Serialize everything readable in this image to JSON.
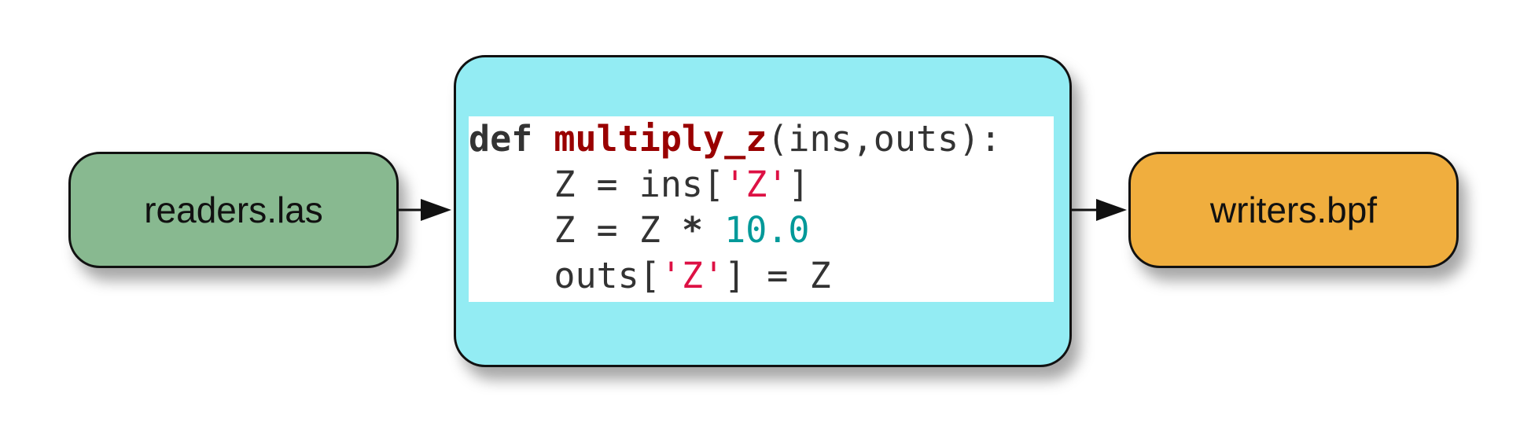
{
  "nodes": {
    "reader": {
      "label": "readers.las",
      "color": "#88b990"
    },
    "filter": {
      "color": "#93ecf3"
    },
    "writer": {
      "label": "writers.bpf",
      "color": "#f0ae3e"
    }
  },
  "code": {
    "lines": [
      [
        {
          "t": "def",
          "k": "kw"
        },
        {
          "t": " ",
          "k": "plain"
        },
        {
          "t": "multiply_z",
          "k": "fn"
        },
        {
          "t": "(ins,outs):",
          "k": "plain"
        }
      ],
      [
        {
          "t": "    Z = ins[",
          "k": "plain"
        },
        {
          "t": "'Z'",
          "k": "str"
        },
        {
          "t": "]",
          "k": "plain"
        }
      ],
      [
        {
          "t": "    Z = Z ",
          "k": "plain"
        },
        {
          "t": "*",
          "k": "kw"
        },
        {
          "t": " ",
          "k": "plain"
        },
        {
          "t": "10.0",
          "k": "num"
        }
      ],
      [
        {
          "t": "    outs[",
          "k": "plain"
        },
        {
          "t": "'Z'",
          "k": "str"
        },
        {
          "t": "] = Z",
          "k": "plain"
        }
      ]
    ]
  },
  "edges": [
    {
      "from": "readers.las",
      "to": "filter"
    },
    {
      "from": "filter",
      "to": "writers.bpf"
    }
  ]
}
